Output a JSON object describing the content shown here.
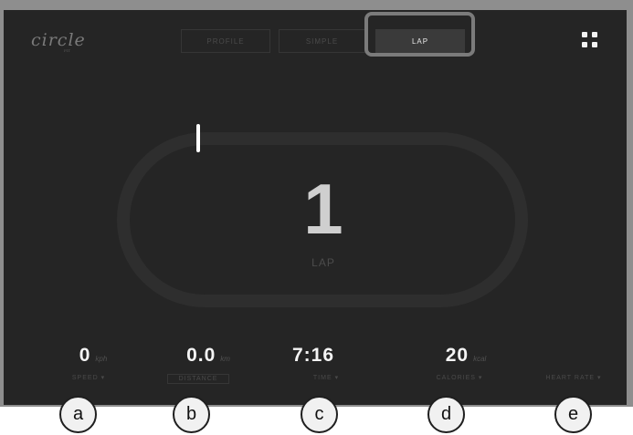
{
  "app": {
    "logo": "circle",
    "logo_sub": "FIT"
  },
  "tabs": [
    {
      "label": "PROFILE",
      "active": false
    },
    {
      "label": "SIMPLE",
      "active": false
    },
    {
      "label": "LAP",
      "active": true
    }
  ],
  "menu_icon": "grid-icon",
  "lap": {
    "number": "1",
    "label": "LAP"
  },
  "metrics": [
    {
      "value": "0",
      "unit": "kph",
      "label": "SPEED ▾"
    },
    {
      "value": "0.0",
      "unit": "km",
      "label": "DISTANCE"
    },
    {
      "value": "7:16",
      "unit": "",
      "label": "TIME ▾"
    },
    {
      "value": "20",
      "unit": "kcal",
      "label": "CALORIES ▾"
    },
    {
      "value": "",
      "unit": "",
      "label": "HEART RATE ▾"
    }
  ],
  "callouts": [
    "a",
    "b",
    "c",
    "d",
    "e"
  ],
  "colors": {
    "screen_bg": "#252525",
    "frame": "#8e8e8e",
    "highlight": "#7b7b7b",
    "active_tab": "#3a3a3a"
  }
}
